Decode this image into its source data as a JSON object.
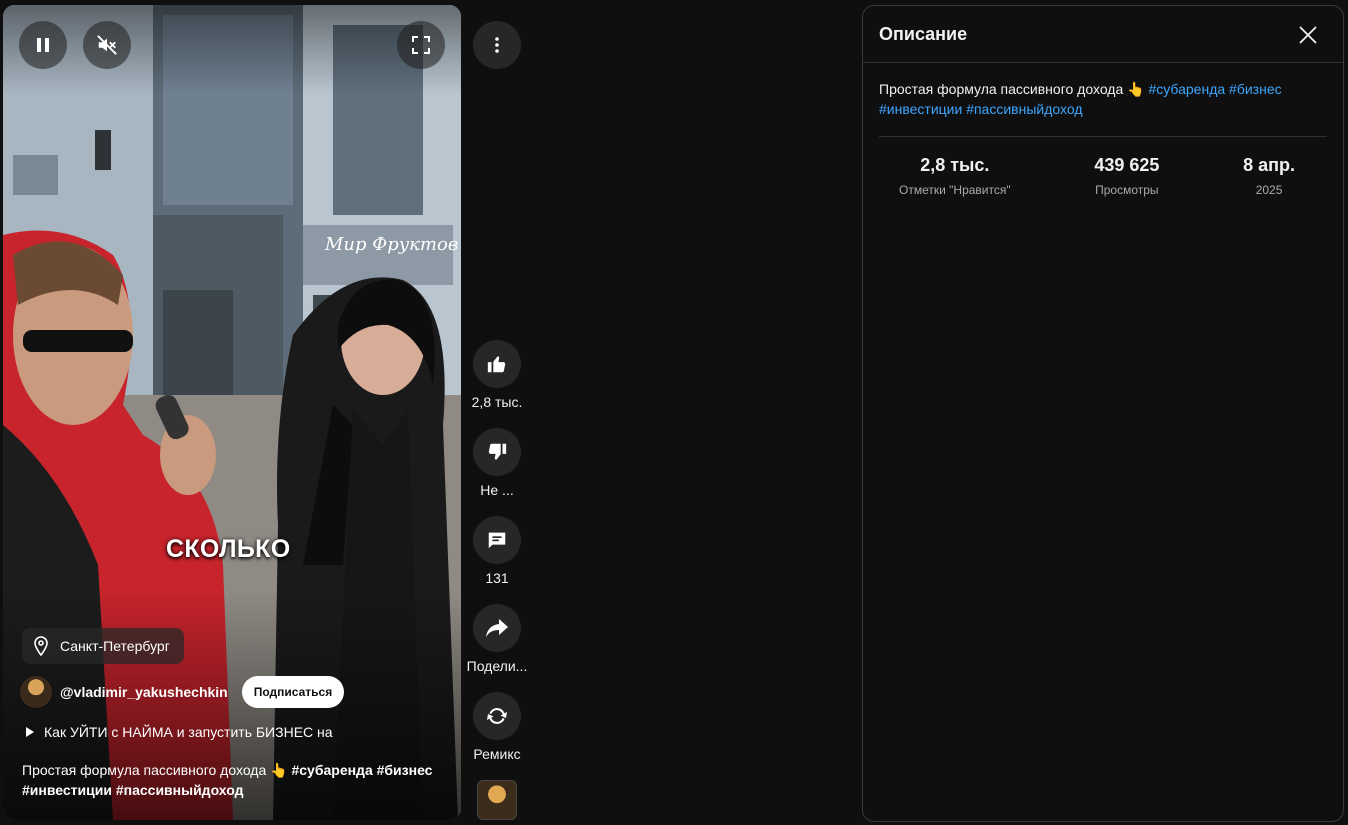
{
  "video": {
    "caption_word": "СКОЛЬКО",
    "sign_text": "Мир Фруктов",
    "location": "Санкт-Петербург",
    "channel_handle": "@vladimir_yakushechkin",
    "subscribe_label": "Подписаться",
    "playlist_title": "Как УЙТИ с НАЙМА и запустить БИЗНЕС на",
    "description_text": "Простая формула пассивного дохода 👆",
    "hashtags": [
      "#субаренда",
      "#бизнес",
      "#инвестиции",
      "#пассивныйдоход"
    ]
  },
  "actions": {
    "like_label": "2,8 тыс.",
    "dislike_label": "Не ...",
    "comments_label": "131",
    "share_label": "Подели...",
    "remix_label": "Ремикс"
  },
  "panel": {
    "title": "Описание",
    "description_text": "Простая формула пассивного дохода 👆",
    "hashtags": [
      "#субаренда",
      "#бизнес",
      "#инвестиции",
      "#пассивныйдоход"
    ],
    "stats": [
      {
        "value": "2,8 тыс.",
        "label": "Отметки \"Нравится\""
      },
      {
        "value": "439 625",
        "label": "Просмотры"
      },
      {
        "value": "8 апр.",
        "label": "2025"
      }
    ]
  },
  "icons": {
    "pause": "pause-icon",
    "mute": "volume-off-icon",
    "fullscreen": "fullscreen-icon",
    "more": "more-vert-icon",
    "like": "thumb-up-icon",
    "dislike": "thumb-down-icon",
    "comments": "comment-icon",
    "share": "share-icon",
    "remix": "remix-icon",
    "location": "location-pin-icon",
    "play": "play-arrow-icon",
    "close": "close-icon"
  },
  "colors": {
    "background": "#0f0f0f",
    "link": "#3ea6ff",
    "button_dark": "#272727",
    "subscribe_bg": "#ffffff"
  }
}
